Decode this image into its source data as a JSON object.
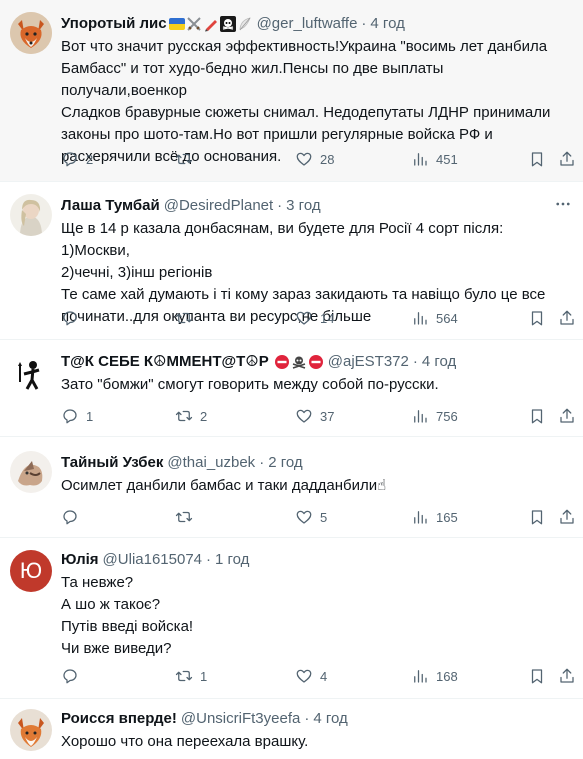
{
  "colors": {
    "secondary_text": "#536471",
    "primary_text": "#0f1419",
    "divider": "#eff3f4",
    "highlight_bg": "#f7f7f7"
  },
  "icons": {
    "reply": "reply-icon",
    "retweet": "retweet-icon",
    "like": "heart-icon",
    "views": "analytics-icon",
    "bookmark": "bookmark-icon",
    "share": "share-icon"
  },
  "tweets": [
    {
      "name": "Упоротый лис",
      "badges": [
        "ukraine-flag",
        "crossed-swords",
        "pencil",
        "skull-and-crossbones",
        "white-feather"
      ],
      "handle": "@ger_luftwaffe",
      "dot": "·",
      "time": "4 год",
      "text": "Вот что значит русская эффективность!Украина \"восимь лет данбила\nБамбасс\" и тот худо-бедно жил.Пенсы по две выплаты получали,военкор\nСладков бравурные сюжеты снимал. Недодепутаты ЛДНР принимали\nзаконы про шото-там.Но вот пришли регулярные войска РФ и\nрасхерячили всё до основания.",
      "replies": "2",
      "retweets": "",
      "likes": "28",
      "views": "451"
    },
    {
      "name": "Лаша Тумбай",
      "badges": [],
      "handle": "@DesiredPlanet",
      "dot": "·",
      "time": "3 год",
      "text": "Ще в 14 р казала донбасянам, ви будете для Росії 4 сорт після: 1)Москви,\n2)чечні, 3)інш регіонів\nТе саме хай думають і ті кому зараз закидають та навіщо було це все\nпочинати..для окупанта ви ресурс,не більше",
      "replies": "",
      "retweets": "",
      "likes": "14",
      "views": "564"
    },
    {
      "name": "Т@К СЕБЕ К☮ММЕНТ@Т☮Р",
      "badges": [
        "no-entry",
        "skull-and-crossbones",
        "no-entry"
      ],
      "handle": "@ajEST372",
      "dot": "·",
      "time": "4 год",
      "text": "Зато \"бомжи\" смогут говорить между собой по-русски.",
      "replies": "1",
      "retweets": "2",
      "likes": "37",
      "views": "756"
    },
    {
      "name": "Тайный Узбек",
      "badges": [],
      "handle": "@thai_uzbek",
      "dot": "·",
      "time": "2 год",
      "text": "Осимлет данбили бамбас и таки дадданбили☝",
      "replies": "",
      "retweets": "",
      "likes": "5",
      "views": "165"
    },
    {
      "name": "Юлія",
      "badges": [],
      "handle": "@Ulia1615074",
      "dot": "·",
      "time": "1 год",
      "avatar_letter": "Ю",
      "text": "Та невже?\nА шо ж такоє?\nПутів введі войска!\nЧи вже виведи?",
      "replies": "",
      "retweets": "1",
      "likes": "4",
      "views": "168"
    },
    {
      "name": "Роисся вперде!",
      "badges": [],
      "handle": "@UnsicriFt3yeefa",
      "dot": "·",
      "time": "4 год",
      "text": "Хорошо что она переехала врашку.",
      "replies": "",
      "retweets": "",
      "likes": "",
      "views": ""
    }
  ]
}
